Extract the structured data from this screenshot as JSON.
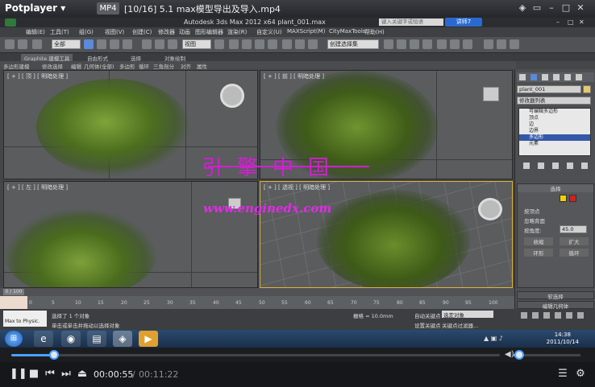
{
  "player": {
    "app_name": "Potplayer ▾",
    "format_badge": "MP4",
    "file_title": "[10/16] 5.1 max模型导出及导入.mp4",
    "current_time": "00:00:55",
    "separator": "/",
    "total_time": "00:11:22",
    "seek_progress": 0.088,
    "volume_level": 0.1
  },
  "max": {
    "title": "Autodesk 3ds Max 2012 x64     plant_001.max",
    "search_placeholder": "键入关键字或短语",
    "help_label": "讲师7",
    "menus": [
      "编辑(E)",
      "工具(T)",
      "组(G)",
      "视图(V)",
      "创建(C)",
      "修改器",
      "动画",
      "图形编辑器",
      "渲染(R)",
      "自定义(U)",
      "MAXScript(M)",
      "CityMaxTools",
      "MAXScript(M)",
      "帮助(H)"
    ],
    "toolbar": {
      "filter_select": "全部",
      "view_select": "视图",
      "named_select": "创建选择集"
    },
    "ribbon_tabs": [
      "Graphite 建模工具",
      "自由形式",
      "选择",
      "对象绘制"
    ],
    "ribbon_sub": [
      "多边形建模",
      "修改选择",
      "编辑",
      "几何体(全部)",
      "多边形",
      "循环",
      "三角剖分",
      "对齐",
      "属性"
    ],
    "viewports": {
      "top": "[ + ] [ 顶 ] [ 明暗处理 ]",
      "front": "[ + ] [ 前 ] [ 明暗处理 ]",
      "left": "[ + ] [ 左 ] [ 明暗处理 ]",
      "perspective": "[ + ] [ 透视 ] [ 明暗处理 ]"
    },
    "cmd_panel": {
      "object_name": "plant_001",
      "modifier_list": "修改器列表",
      "stack_items": [
        "可编辑多边形",
        "顶点",
        "边",
        "边界",
        "多边形",
        "元素"
      ],
      "selected_index": 4,
      "rollout_title": "选择",
      "options": [
        "按顶点",
        "忽略背面",
        "按角度:",
        "收缩",
        "扩大",
        "环形",
        "循环"
      ],
      "angle_value": "45.0",
      "soft_selection": "软选择",
      "edit_geometry": "编辑几何体"
    },
    "frame_range": "0 / 100",
    "ticks": [
      "0",
      "5",
      "10",
      "15",
      "20",
      "25",
      "30",
      "35",
      "40",
      "45",
      "50",
      "55",
      "60",
      "65",
      "70",
      "75",
      "80",
      "85",
      "90",
      "95",
      "100"
    ],
    "status": {
      "selected": "选择了 1 个对象",
      "prompt": "单击或单击并拖动以选择对象",
      "maxscript_hint": "Max to Physic.",
      "grid": "栅格 = 10.0mm",
      "autokey": "自动关键点",
      "set_key": "设置关键点",
      "selected_obj": "选定对象",
      "key_filter": "关键点过滤器..."
    }
  },
  "taskbar": {
    "time": "14:38",
    "date": "2011/10/14"
  },
  "watermark": {
    "chinese": "引擎中国",
    "url": "www.enginedx.com"
  },
  "colors": {
    "accent": "#4aa3ff",
    "watermark": "#d21fd3",
    "stack_highlight": "#3358a8"
  }
}
